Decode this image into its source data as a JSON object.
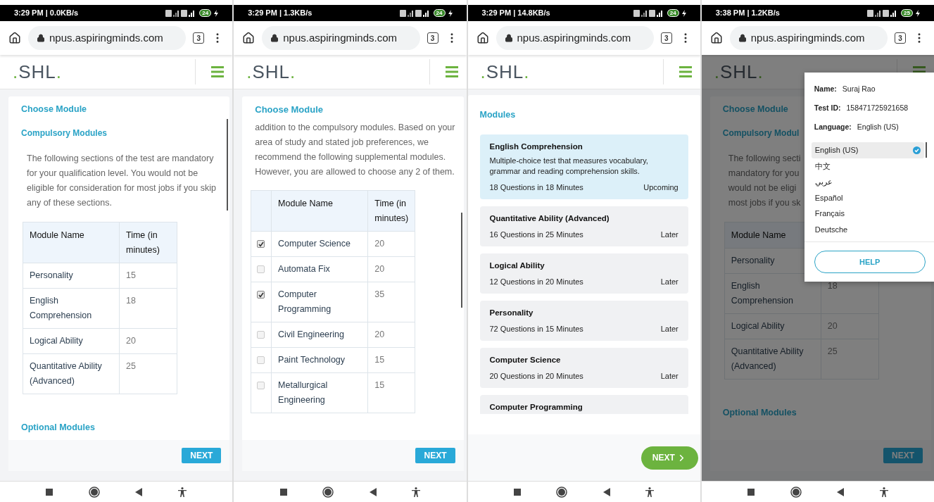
{
  "phones": [
    {
      "status_bar": {
        "time": "3:29 PM | 0.0KB/s",
        "battery": "24"
      },
      "browser": {
        "url": "npus.aspiringminds.com",
        "tab_count": "3"
      },
      "logo": ".SHL.",
      "dimmed": false,
      "page": {
        "kind": "compulsory",
        "heading": "Choose Module",
        "section": "Compulsory Modules",
        "intro": "The following sections of the test are mandatory for your qualification level. You would not be eligible for consideration for most jobs if you skip any of these sections.",
        "table": {
          "columns": [
            "Module Name",
            "Time (in minutes)"
          ],
          "rows": [
            {
              "name": "Personality",
              "time": "15"
            },
            {
              "name": "English Comprehension",
              "time": "18"
            },
            {
              "name": "Logical Ability",
              "time": "20"
            },
            {
              "name": "Quantitative Ability (Advanced)",
              "time": "25"
            }
          ]
        },
        "subheading": "Optional Modules",
        "next": "NEXT"
      }
    },
    {
      "status_bar": {
        "time": "3:29 PM | 1.3KB/s",
        "battery": "24"
      },
      "browser": {
        "url": "npus.aspiringminds.com",
        "tab_count": "3"
      },
      "logo": ".SHL.",
      "dimmed": false,
      "page": {
        "kind": "optional",
        "heading": "Choose Module",
        "intro": "addition to the compulsory modules. Based on your area of study and stated job preferences, we recommend the following supplemental modules. However, you are allowed to choose any 2 of them.",
        "table": {
          "columns": [
            "Module Name",
            "Time (in minutes)"
          ],
          "rows": [
            {
              "checked": true,
              "name": "Computer Science",
              "time": "20"
            },
            {
              "checked": false,
              "name": "Automata Fix",
              "time": "20"
            },
            {
              "checked": true,
              "name": "Computer Programming",
              "time": "35"
            },
            {
              "checked": false,
              "name": "Civil Engineering",
              "time": "20"
            },
            {
              "checked": false,
              "name": "Paint Technology",
              "time": "15"
            },
            {
              "checked": false,
              "name": "Metallurgical Engineering",
              "time": "15"
            }
          ]
        },
        "next": "NEXT"
      }
    },
    {
      "status_bar": {
        "time": "3:29 PM | 14.8KB/s",
        "battery": "24"
      },
      "browser": {
        "url": "npus.aspiringminds.com",
        "tab_count": "3"
      },
      "logo": ".SHL.",
      "dimmed": false,
      "page": {
        "kind": "modules",
        "heading": "Modules",
        "modules": [
          {
            "selected": true,
            "title": "English Comprehension",
            "description": "Multiple-choice test that measures vocabulary, grammar and reading comprehension skills.",
            "meta": "18 Questions in 18 Minutes",
            "status": "Upcoming"
          },
          {
            "selected": false,
            "title": "Quantitative Ability (Advanced)",
            "meta": "16 Questions in 25 Minutes",
            "status": "Later"
          },
          {
            "selected": false,
            "title": "Logical Ability",
            "meta": "12 Questions in 20 Minutes",
            "status": "Later"
          },
          {
            "selected": false,
            "title": "Personality",
            "meta": "72 Questions in 15 Minutes",
            "status": "Later"
          },
          {
            "selected": false,
            "title": "Computer Science",
            "meta": "20 Questions in 20 Minutes",
            "status": "Later"
          },
          {
            "selected": false,
            "title": "Computer Programming"
          }
        ],
        "next": "NEXT"
      }
    },
    {
      "status_bar": {
        "time": "3:38 PM | 1.2KB/s",
        "battery": "25"
      },
      "browser": {
        "url": "npus.aspiringminds.com",
        "tab_count": "3"
      },
      "logo": ".SHL.",
      "dimmed": true,
      "page": {
        "kind": "compulsory",
        "heading": "Choose Module",
        "section": "Compulsory Modul",
        "intro_lines": [
          "The following secti",
          "mandatory for you",
          "would not be eligi",
          "most jobs if you sk"
        ],
        "table": {
          "columns": [
            "Module Name"
          ],
          "rows": [
            {
              "name": "Personality"
            },
            {
              "name": "English Comprehension",
              "time": "18"
            },
            {
              "name": "Logical Ability",
              "time": "20"
            },
            {
              "name": "Quantitative Ability (Advanced)",
              "time": "25"
            }
          ]
        },
        "subheading": "Optional Modules",
        "next": "NEXT"
      },
      "menu": {
        "fields": [
          {
            "label": "Name:",
            "value": "Suraj Rao"
          },
          {
            "label": "Test ID:",
            "value": "158471725921658"
          },
          {
            "label": "Language:",
            "value": "English (US)"
          }
        ],
        "languages": [
          {
            "label": "English (US)",
            "selected": true
          },
          {
            "label": "中文",
            "selected": false
          },
          {
            "label": "عربي",
            "selected": false
          },
          {
            "label": "Español",
            "selected": false
          },
          {
            "label": "Français",
            "selected": false
          },
          {
            "label": "Deutsche",
            "selected": false
          }
        ],
        "help": "HELP"
      }
    }
  ]
}
